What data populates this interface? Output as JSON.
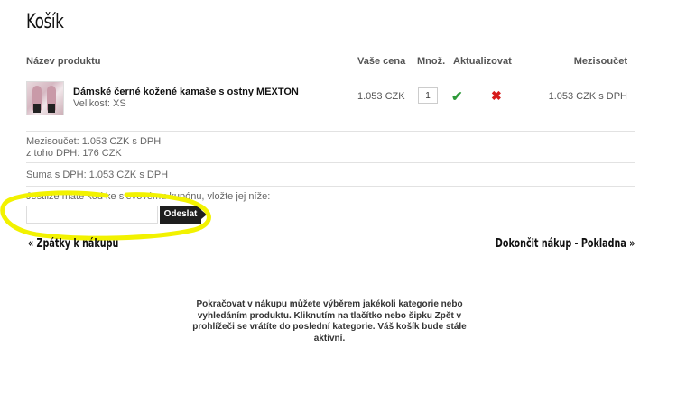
{
  "page": {
    "title": "Košík"
  },
  "table": {
    "headers": {
      "product": "Název produktu",
      "price": "Vaše cena",
      "qty": "Množ.",
      "update": "Aktualizovat",
      "subtotal": "Mezisoučet"
    },
    "rows": [
      {
        "name": "Dámské černé kožené kamaše s ostny MEXTON",
        "variant": "Velikost: XS",
        "price": "1.053 CZK",
        "qty": "1",
        "subtotal": "1.053 CZK s DPH"
      }
    ]
  },
  "summary": {
    "subtotal": "Mezisoučet: 1.053 CZK s DPH",
    "vat": "z toho DPH: 176 CZK",
    "total": "Suma s DPH: 1.053 CZK s DPH"
  },
  "coupon": {
    "label": "Jestliže máte kód ke slevovému kupónu, vložte jej níže:",
    "value": "",
    "button": "Odeslat"
  },
  "nav": {
    "back": "« Zpátky k nákupu",
    "checkout": "Dokončit nákup - Pokladna »"
  },
  "info": "Pokračovat v nákupu můžete výběrem jakékoli kategorie nebo vyhledáním produktu. Kliknutím na tlačítko nebo šipku Zpět v prohlížeči se vrátíte do poslední kategorie. Váš košík bude stále aktivní.",
  "colors": {
    "highlight": "#f2f200",
    "check": "#2e9a3a",
    "cross": "#d61b1b",
    "button": "#1e1e1e"
  },
  "icons": {
    "update": "check-icon",
    "remove": "remove-icon"
  }
}
